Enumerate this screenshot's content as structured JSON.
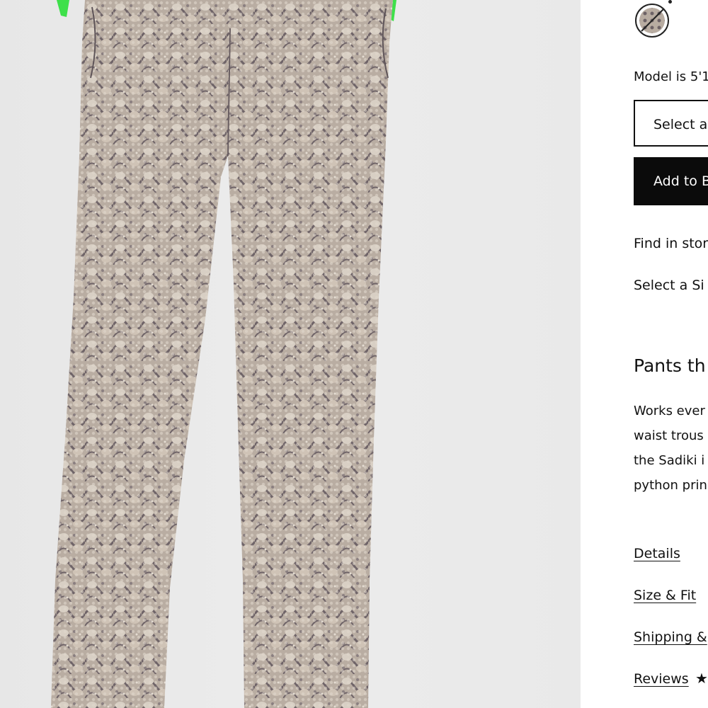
{
  "product": {
    "image_alt": "Python print wide-leg pants worn by model",
    "swatch_icon": "python-print-swatch-icon",
    "model_note": "Model is 5'1",
    "size_select_label": "Select a",
    "add_button_label": "Add to B",
    "find_in_store": "Find in stor",
    "select_size_note": "Select a Si",
    "description_title": "Pants th",
    "description_lines": [
      "Works ever",
      "waist trous",
      "the Sadiki i",
      "python prin"
    ]
  },
  "links": {
    "details": "Details",
    "size_fit": "Size & Fit",
    "shipping": "Shipping &",
    "reviews": "Reviews",
    "reviews_stars": "★"
  },
  "colors": {
    "button_bg": "#0b0b0b",
    "accent_green": "#3ee04a"
  }
}
